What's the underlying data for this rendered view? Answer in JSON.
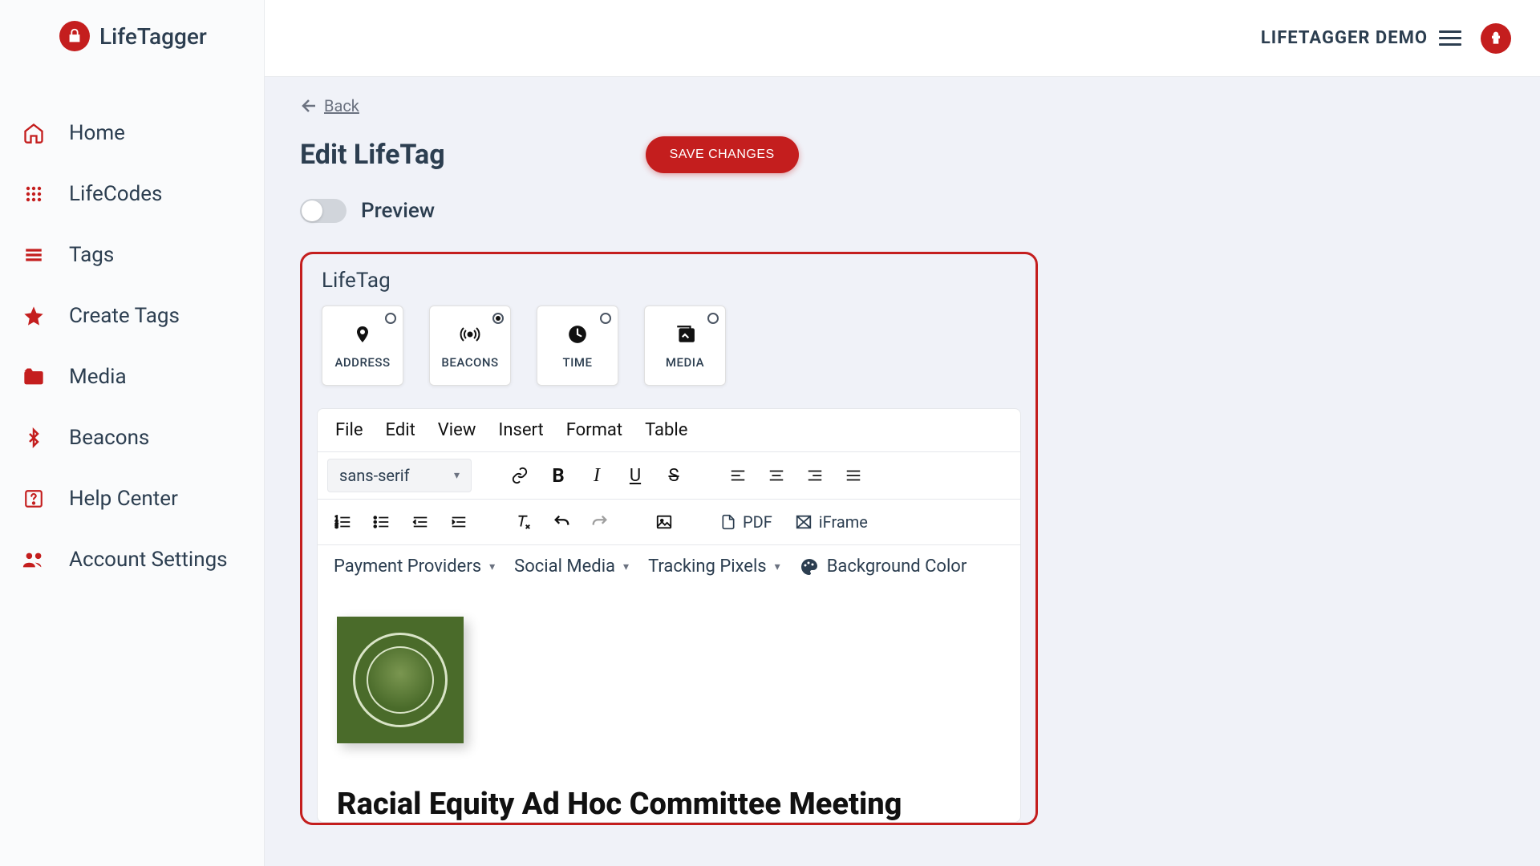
{
  "brand": "LifeTagger",
  "topbar": {
    "org": "LIFETAGGER DEMO"
  },
  "sidebar": {
    "items": [
      {
        "label": "Home"
      },
      {
        "label": "LifeCodes"
      },
      {
        "label": "Tags"
      },
      {
        "label": "Create Tags"
      },
      {
        "label": "Media"
      },
      {
        "label": "Beacons"
      },
      {
        "label": "Help Center"
      },
      {
        "label": "Account Settings"
      }
    ]
  },
  "page": {
    "back": "Back",
    "title": "Edit LifeTag",
    "save_label": "SAVE CHANGES",
    "preview_label": "Preview",
    "section_title": "LifeTag"
  },
  "tiles": [
    {
      "label": "ADDRESS",
      "selected": false
    },
    {
      "label": "BEACONS",
      "selected": true
    },
    {
      "label": "TIME",
      "selected": false
    },
    {
      "label": "MEDIA",
      "selected": false
    }
  ],
  "editor": {
    "menu": {
      "file": "File",
      "edit": "Edit",
      "view": "View",
      "insert": "Insert",
      "format": "Format",
      "table": "Table"
    },
    "font": "sans-serif",
    "pdf_label": "PDF",
    "iframe_label": "iFrame",
    "dropdowns": {
      "payment": "Payment Providers",
      "social": "Social Media",
      "tracking": "Tracking Pixels",
      "bg": "Background Color"
    },
    "doc_heading": "Racial Equity Ad Hoc Committee Meeting"
  }
}
